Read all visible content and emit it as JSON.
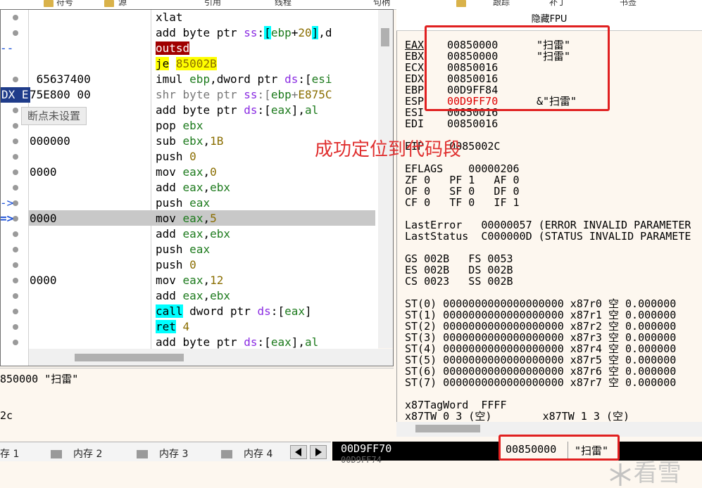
{
  "toolbar": {
    "items": [
      "符号",
      "源",
      "引用",
      "线程",
      "句柄",
      "跟踪",
      "补丁",
      "书签"
    ]
  },
  "tooltip": "断点未设置",
  "annotation": "成功定位到代码段",
  "disasm": {
    "rows": [
      {
        "addr_tail": "",
        "arrow": "",
        "gutter": "dot",
        "code": "xlat"
      },
      {
        "addr_tail": "",
        "arrow": "",
        "gutter": "dot",
        "code": "add byte ptr ss:[ebp+20],d"
      },
      {
        "addr_tail": "",
        "arrow": "--",
        "gutter": "none",
        "code": "outsd"
      },
      {
        "addr_tail": "",
        "arrow": "",
        "gutter": "none",
        "code": "je 85002B"
      },
      {
        "addr_tail": " 65637400",
        "arrow": "",
        "gutter": "dot",
        "code": "imul ebp,dword ptr ds:[esi"
      },
      {
        "addr_tail": "75E800 00",
        "arrow": "DX E",
        "gutter": "none",
        "code": "shr byte ptr ss:[ebp+E875C"
      },
      {
        "addr_tail": "",
        "arrow": "",
        "gutter": "dot",
        "code": "add byte ptr ds:[eax],al"
      },
      {
        "addr_tail": "",
        "arrow": "",
        "gutter": "dot",
        "code": "pop ebx"
      },
      {
        "addr_tail": "000000",
        "arrow": "",
        "gutter": "dot",
        "code": "sub ebx,1B"
      },
      {
        "addr_tail": "",
        "arrow": "",
        "gutter": "dot",
        "code": "push 0"
      },
      {
        "addr_tail": "0000",
        "arrow": "",
        "gutter": "dot",
        "code": "mov eax,0"
      },
      {
        "addr_tail": "",
        "arrow": "",
        "gutter": "dot",
        "code": "add eax,ebx"
      },
      {
        "addr_tail": "",
        "arrow": "->",
        "gutter": "dot",
        "code": "push eax"
      },
      {
        "addr_tail": "0000",
        "arrow": "=>",
        "gutter": "dot",
        "code": "mov eax,5"
      },
      {
        "addr_tail": "",
        "arrow": "",
        "gutter": "dot",
        "code": "add eax,ebx"
      },
      {
        "addr_tail": "",
        "arrow": "",
        "gutter": "dot",
        "code": "push eax"
      },
      {
        "addr_tail": "",
        "arrow": "",
        "gutter": "dot",
        "code": "push 0"
      },
      {
        "addr_tail": "0000",
        "arrow": "",
        "gutter": "dot",
        "code": "mov eax,12"
      },
      {
        "addr_tail": "",
        "arrow": "",
        "gutter": "dot",
        "code": "add eax,ebx"
      },
      {
        "addr_tail": "",
        "arrow": "",
        "gutter": "dot",
        "code": "call dword ptr ds:[eax]"
      },
      {
        "addr_tail": "",
        "arrow": "",
        "gutter": "dot",
        "code": "ret 4"
      },
      {
        "addr_tail": "",
        "arrow": "",
        "gutter": "dot",
        "code": "add byte ptr ds:[eax],al"
      }
    ]
  },
  "dump": {
    "line1": "850000 \"扫雷\"",
    "line2": "2c"
  },
  "fpu": {
    "header": "隐藏FPU",
    "regs": [
      {
        "name": "EAX",
        "value": "00850000",
        "comment": "\"扫雷\""
      },
      {
        "name": "EBX",
        "value": "00850000",
        "comment": "\"扫雷\""
      },
      {
        "name": "ECX",
        "value": "00850016",
        "comment": ""
      },
      {
        "name": "EDX",
        "value": "00850016",
        "comment": ""
      },
      {
        "name": "EBP",
        "value": "00D9FF84",
        "comment": ""
      },
      {
        "name": "ESP",
        "value": "00D9FF70",
        "comment": "&\"扫雷\""
      },
      {
        "name": "ESI",
        "value": "00850016",
        "comment": ""
      },
      {
        "name": "EDI",
        "value": "00850016",
        "comment": ""
      }
    ],
    "eip": "EIP    0085002C",
    "eflags": "EFLAGS    00000206",
    "flags": [
      "ZF 0   PF 1   AF 0",
      "OF 0   SF 0   DF 0",
      "CF 0   TF 0   IF 1"
    ],
    "lasterror": "LastError   00000057 (ERROR_INVALID_PARAMETER",
    "laststatus": "LastStatus  C000000D (STATUS_INVALID_PARAMETE",
    "segs": [
      "GS 002B   FS 0053",
      "ES 002B   DS 002B",
      "CS 0023   SS 002B"
    ],
    "st": [
      "ST(0) 0000000000000000000 x87r0 空 0.000000",
      "ST(1) 0000000000000000000 x87r1 空 0.000000",
      "ST(2) 0000000000000000000 x87r2 空 0.000000",
      "ST(3) 0000000000000000000 x87r3 空 0.000000",
      "ST(4) 0000000000000000000 x87r4 空 0.000000",
      "ST(5) 0000000000000000000 x87r5 空 0.000000",
      "ST(6) 0000000000000000000 x87r6 空 0.000000",
      "ST(7) 0000000000000000000 x87r7 空 0.000000"
    ],
    "tagword": "x87TagWord  FFFF",
    "tw": "x87TW_0 3 (空)        x87TW_1 3 (空)"
  },
  "tabs": [
    {
      "label": "存 1"
    },
    {
      "label": "内存 2"
    },
    {
      "label": "内存 3"
    },
    {
      "label": "内存 4"
    }
  ],
  "stack": {
    "addr": "00D9FF70",
    "addr2": "00D9FF74",
    "value": "00850000",
    "comment": "\"扫雷\""
  },
  "watermark": "看雪"
}
